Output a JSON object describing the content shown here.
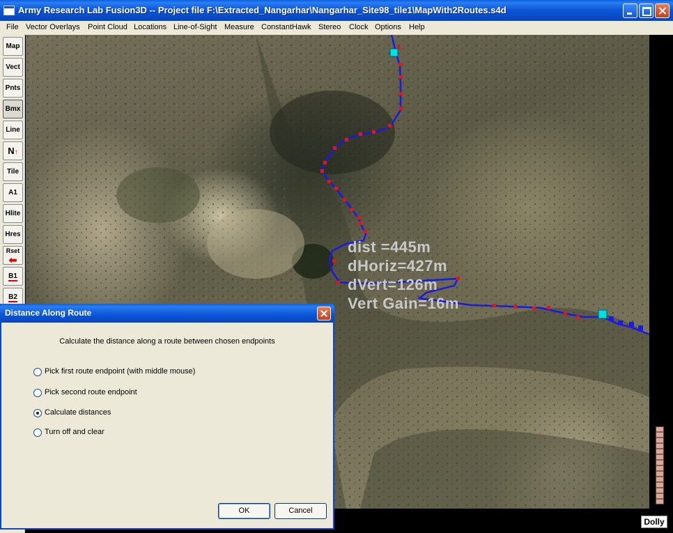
{
  "window": {
    "title": "Army Research Lab Fusion3D -- Project file F:\\Extracted_Nangarhar\\Nangarhar_Site98_tile1\\MapWith2Routes.s4d"
  },
  "menu": [
    "File",
    "Vector Overlays",
    "Point Cloud",
    "Locations",
    "Line-of-Sight",
    "Measure",
    "ConstantHawk",
    "Stereo",
    "Clock",
    "Options",
    "Help"
  ],
  "toolbar": {
    "map": "Map",
    "vect": "Vect",
    "pnts": "Pnts",
    "bmx": "Bmx",
    "line": "Line",
    "north": "N",
    "tile": "Tile",
    "a1": "A1",
    "hlite": "Hlite",
    "hres": "Hres",
    "rset": "Rset",
    "b1": "B1",
    "b2": "B2"
  },
  "readout": {
    "dist": "dist =445m",
    "dhoriz": "dHoriz=427m",
    "dvert": "dVert=126m",
    "vert_gain": "Vert Gain=16m"
  },
  "status": {
    "mode": "Dolly"
  },
  "colors": {
    "route_line": "#1a1ae0",
    "route_marker": "#e01818",
    "endpoint": "#00e0e0",
    "readout_text": "#c8c8c8"
  },
  "dialog": {
    "title": "Distance Along Route",
    "description": "Calculate the distance along a route between chosen endpoints",
    "options": [
      {
        "label": "Pick first route endpoint (with middle mouse)",
        "checked": false
      },
      {
        "label": "Pick second route endpoint",
        "checked": false
      },
      {
        "label": "Calculate distances",
        "checked": true
      },
      {
        "label": "Turn off and clear",
        "checked": false
      }
    ],
    "ok_label": "OK",
    "cancel_label": "Cancel"
  }
}
